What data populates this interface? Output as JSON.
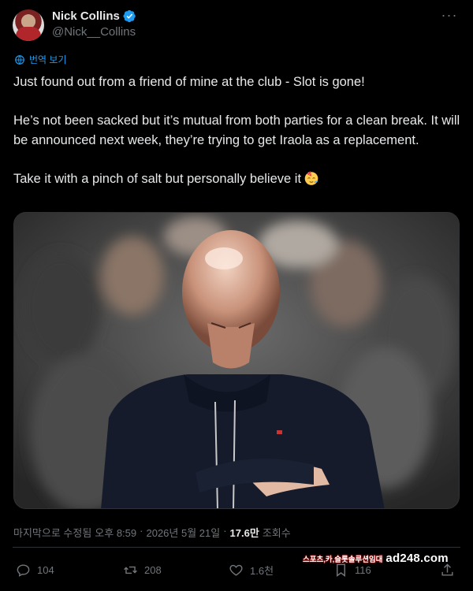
{
  "author": {
    "display_name": "Nick Collins",
    "handle": "@Nick__Collins",
    "verified": true
  },
  "more_icon": "more-horizontal-icon",
  "translate": {
    "label": "번역 보기",
    "icon": "translate-icon"
  },
  "tweet": {
    "paragraphs": [
      "Just found out from a friend of mine at the club - Slot is gone!",
      "He’s not been sacked but it’s mutual from both parties for a clean break. It will be announced next week, they’re trying to get Iraola as a replacement.",
      "Take it with a pinch of salt but personally believe it"
    ],
    "emoji": "partying-face-emoji"
  },
  "meta": {
    "edited_label": "마지막으로 수정됨",
    "time": "오후 8:59",
    "separator": "·",
    "date": "2026년 5월 21일",
    "views_count": "17.6만",
    "views_label": "조회수"
  },
  "actions": {
    "replies": "104",
    "reposts": "208",
    "likes": "1.6천",
    "bookmarks": "116"
  },
  "watermark": {
    "small": "스포츠,카,슬롯솔루션임대",
    "big": "ad248.com"
  },
  "colors": {
    "background": "#000000",
    "text": "#e7e9ea",
    "secondary": "#71767b",
    "accent": "#1d9bf0"
  }
}
